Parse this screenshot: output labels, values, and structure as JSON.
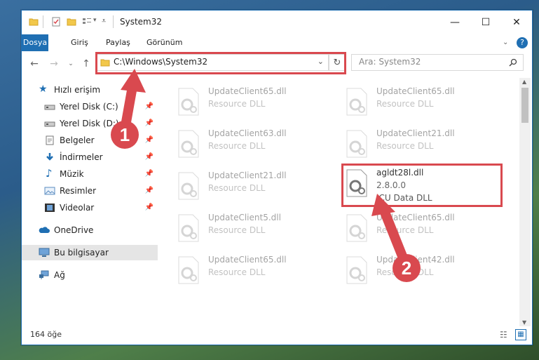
{
  "window": {
    "title": "System32",
    "minimize_label": "—",
    "maximize_label": "☐",
    "close_label": "✕"
  },
  "ribbon": {
    "tabs": [
      "Dosya",
      "Giriş",
      "Paylaş",
      "Görünüm"
    ],
    "help_label": "?"
  },
  "address": {
    "path": "C:\\Windows\\System32",
    "search_placeholder": "Ara: System32"
  },
  "sidebar": {
    "items": [
      {
        "label": "Hızlı erişim",
        "icon": "star-icon"
      },
      {
        "label": "Yerel Disk (C:)",
        "icon": "drive-icon",
        "pinned": true
      },
      {
        "label": "Yerel Disk (D:)",
        "icon": "drive-icon",
        "pinned": true
      },
      {
        "label": "Belgeler",
        "icon": "documents-icon",
        "pinned": true
      },
      {
        "label": "İndirmeler",
        "icon": "download-icon",
        "pinned": true
      },
      {
        "label": "Müzik",
        "icon": "music-icon",
        "pinned": true
      },
      {
        "label": "Resimler",
        "icon": "pictures-icon",
        "pinned": true
      },
      {
        "label": "Videolar",
        "icon": "videos-icon",
        "pinned": true
      },
      {
        "label": "OneDrive",
        "icon": "cloud-icon"
      },
      {
        "label": "Bu bilgisayar",
        "icon": "computer-icon"
      },
      {
        "label": "Ağ",
        "icon": "network-icon"
      }
    ]
  },
  "files": [
    {
      "name": "UpdateClient65.dll",
      "desc": "Resource DLL"
    },
    {
      "name": "UpdateClient65.dll",
      "desc": "Resource DLL"
    },
    {
      "name": "UpdateClient63.dll",
      "desc": "Resource DLL"
    },
    {
      "name": "UpdateClient21.dll",
      "desc": "Resource DLL"
    },
    {
      "name": "UpdateClient21.dll",
      "desc": "Resource DLL"
    },
    {
      "name": "agldt28l.dll",
      "version": "2.8.0.0",
      "desc": "ICU Data DLL"
    },
    {
      "name": "UpdateClient5.dll",
      "desc": "Resource DLL"
    },
    {
      "name": "UpdateClient65.dll",
      "desc": "Resource DLL"
    },
    {
      "name": "UpdateClient65.dll",
      "desc": "Resource DLL"
    },
    {
      "name": "UpdateClient42.dll",
      "desc": "Resource DLL"
    }
  ],
  "status": {
    "item_count": "164 öğe"
  },
  "markers": {
    "step1": "1",
    "step2": "2"
  },
  "colors": {
    "accent": "#1f6fb3",
    "highlight": "#d9494f",
    "selection": "#e5e5e5"
  }
}
